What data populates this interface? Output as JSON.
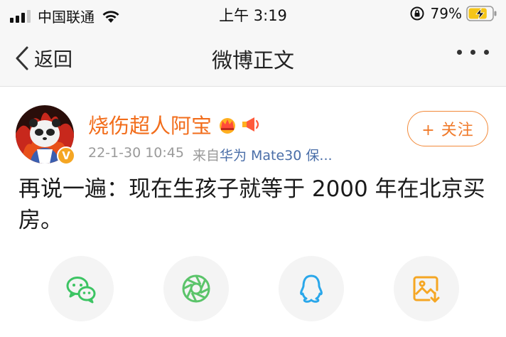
{
  "status_bar": {
    "carrier": "中国联通",
    "time": "上午 3:19",
    "battery_percent": "79%",
    "battery_level": 0.79,
    "icons": [
      "signal-icon",
      "wifi-icon",
      "orientation-lock-icon",
      "battery-charging-icon"
    ]
  },
  "nav": {
    "back_label": "返回",
    "title": "微博正文",
    "more_icon": "more-dots-icon"
  },
  "post": {
    "username": "烧伤超人阿宝",
    "badges": [
      "crown-icon",
      "megaphone-icon"
    ],
    "verified_badge": "V",
    "timestamp": "22-1-30 10:45",
    "source_prefix": "来自",
    "source": "华为 Mate30 保...",
    "follow_label": "+ 关注",
    "text": "再说一遍：现在生孩子就等于 2000 年在北京买房。"
  },
  "share": {
    "items": [
      "wechat-icon",
      "moments-icon",
      "qq-icon",
      "save-image-icon"
    ]
  },
  "colors": {
    "accent": "#f26d1b",
    "source_link": "#4a6ea8",
    "wechat": "#3cc463",
    "moments": "#5bc46a",
    "qq": "#2aa7ea",
    "save": "#f5a623"
  }
}
